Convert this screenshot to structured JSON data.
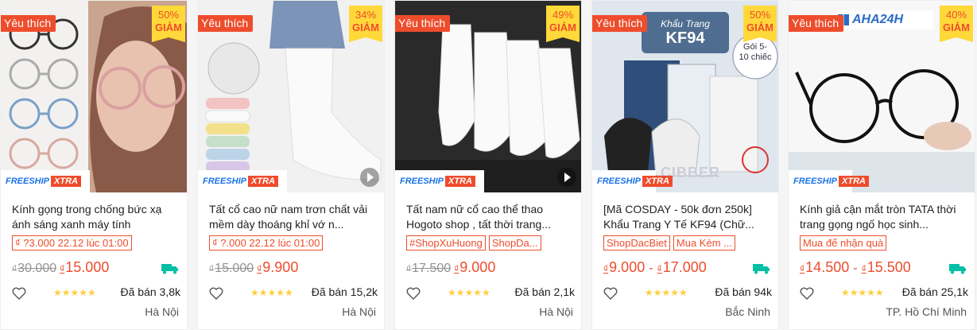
{
  "colors": {
    "accent": "#ee4d2d",
    "badge": "#ffd839",
    "star": "#ffce3d",
    "freeship_blue": "#1a73e8"
  },
  "common": {
    "fav_label": "Yêu thích",
    "discount_word": "GIẢM",
    "freeship_left": "FREESHIP",
    "freeship_right": "XTRA",
    "stars": "★★★★★",
    "currency": "₫",
    "price_sep": "-"
  },
  "products": [
    {
      "image_desc": "glasses-woman",
      "discount": "50%",
      "title": "Kính gọng trong chống bức xạ ánh sáng xanh máy tính",
      "tags": [
        "₫ ?3.000 22.12 lúc 01:00"
      ],
      "old_price": "30.000",
      "price": "15.000",
      "price_max": "",
      "sold": "Đã bán 3,8k",
      "location": "Hà Nội",
      "has_video": false,
      "freeship_truck": true
    },
    {
      "image_desc": "white-socks-leg",
      "discount": "34%",
      "title": "Tất cổ cao nữ nam trơn chất vải mềm dày thoáng khỉ vớ n...",
      "tags": [
        "₫ ?.000 22.12 lúc 01:00"
      ],
      "old_price": "15.000",
      "price": "9.900",
      "price_max": "",
      "sold": "Đã bán 15,2k",
      "location": "Hà Nội",
      "has_video": true,
      "freeship_truck": false
    },
    {
      "image_desc": "white-socks-flat",
      "discount": "49%",
      "title": "Tất nam nữ cổ cao thể thao Hogoto shop , tất thời trang...",
      "tags": [
        "#ShopXuHuong",
        "ShopDa..."
      ],
      "old_price": "17.500",
      "price": "9.000",
      "price_max": "",
      "sold": "Đã bán 2,1k",
      "location": "Hà Nội",
      "has_video": true,
      "freeship_truck": false
    },
    {
      "image_desc": "kf94-masks",
      "discount": "50%",
      "title": "[Mã COSDAY - 50k đơn 250k] Khẩu Trang Y Tế KF94 (Chữ...",
      "tags": [
        "ShopDacBiet",
        "Mua Kèm ..."
      ],
      "old_price": "",
      "price": "9.000",
      "price_max": "17.000",
      "sold": "Đã bán 94k",
      "location": "Bắc Ninh",
      "has_video": false,
      "freeship_truck": true,
      "banner_title": "Khẩu Trang",
      "banner_model": "KF94",
      "banner_pack": "Gói 5-10 chiếc",
      "brand_mark": "CIBBER"
    },
    {
      "image_desc": "round-glasses",
      "discount": "40%",
      "title": "Kính giả cận mắt tròn TATA thời trang gọng ngố học sinh...",
      "tags": [
        "Mua để nhận quà"
      ],
      "old_price": "",
      "price": "14.500",
      "price_max": "15.500",
      "sold": "Đã bán 25,1k",
      "location": "TP. Hồ Chí Minh",
      "has_video": false,
      "freeship_truck": true,
      "brand_mark": "AHA24H"
    }
  ]
}
